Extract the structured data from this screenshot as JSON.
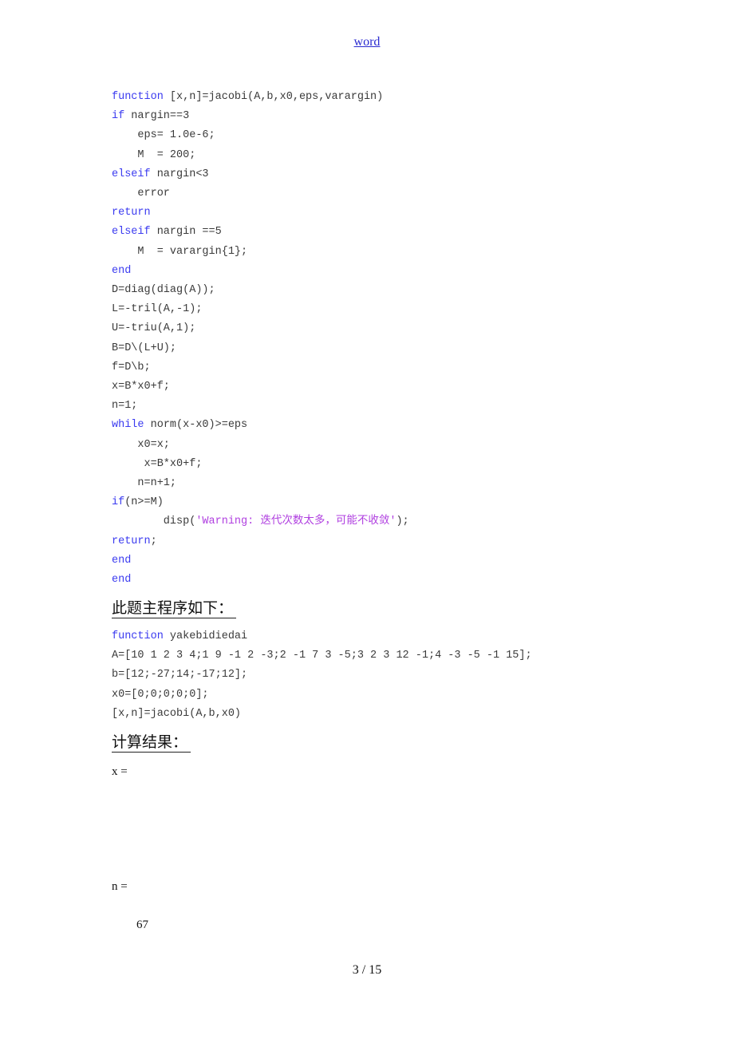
{
  "header": {
    "link_text": "word"
  },
  "jacobi_code": {
    "l1_kw": "function",
    "l1_rest": " [x,n]=jacobi(A,b,x0,eps,varargin)",
    "l2_kw": "if",
    "l2_rest": " nargin==3",
    "l3": "    eps= 1.0e-6;",
    "l4": "    M  = 200;",
    "l5_kw": "elseif",
    "l5_rest": " nargin<3",
    "l6": "    error",
    "l7_kw": "return",
    "l8_kw": "elseif",
    "l8_rest": " nargin ==5",
    "l9": "    M  = varargin{1};",
    "l10_kw": "end",
    "l11": "D=diag(diag(A));",
    "l12": "L=-tril(A,-1);",
    "l13": "U=-triu(A,1);",
    "l14": "B=D\\(L+U);",
    "l15": "f=D\\b;",
    "l16": "x=B*x0+f;",
    "l17": "n=1;",
    "l18_kw": "while",
    "l18_rest": " norm(x-x0)>=eps",
    "l19": "    x0=x;",
    "l20": "     x=B*x0+f;",
    "l21": "    n=n+1;",
    "l22_kw": "if",
    "l22_rest": "(n>=M)",
    "l23_pre": "        disp(",
    "l23_str": "'Warning: 迭代次数太多，可能不收敛'",
    "l23_post": ");",
    "l24_kw": "return",
    "l24_rest": ";",
    "l25_kw": "end",
    "l26_kw": "end"
  },
  "main_heading": "此题主程序如下：",
  "main_code": {
    "l1_kw": "function",
    "l1_rest": " yakebidiedai",
    "l2": "A=[10 1 2 3 4;1 9 -1 2 -3;2 -1 7 3 -5;3 2 3 12 -1;4 -3 -5 -1 15];",
    "l3": "b=[12;-27;14;-17;12];",
    "l4": "x0=[0;0;0;0;0];",
    "l5": "[x,n]=jacobi(A,b,x0)"
  },
  "result_heading": "计算结果：",
  "results": {
    "x_label": "x =",
    "n_label": "n =",
    "n_value": "67"
  },
  "footer": {
    "page_indicator": "3 / 15"
  },
  "colors": {
    "keyword": "#3b3bf0",
    "string": "#b040e0",
    "code_text": "#3a3a3a",
    "header_link": "#2a2ad0"
  }
}
